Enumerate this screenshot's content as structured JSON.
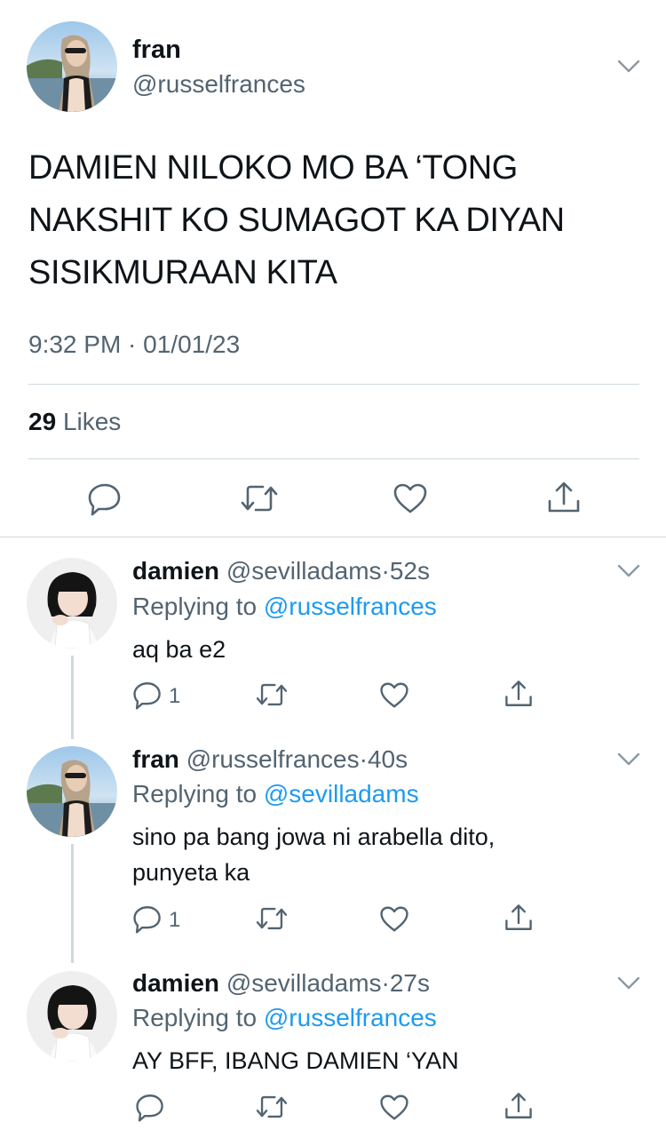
{
  "main_tweet": {
    "name": "fran",
    "handle": "@russelfrances",
    "text": "DAMIEN NILOKO MO BA ‘TONG NAKSHIT KO SUMAGOT KA DIYAN SISIKMURAAN KITA",
    "timestamp": "9:32 PM · 01/01/23",
    "likes_count": "29",
    "likes_label": "Likes",
    "actions": [
      "reply-icon",
      "retweet-icon",
      "like-icon",
      "share-icon"
    ]
  },
  "replies": [
    {
      "name": "damien",
      "handle": "@sevilladams",
      "time": "52s",
      "replying_prefix": "Replying to",
      "replying_to": "@russelfrances",
      "text": "aq ba e2",
      "reply_count": "1"
    },
    {
      "name": "fran",
      "handle": "@russelfrances",
      "time": "40s",
      "replying_prefix": "Replying to",
      "replying_to": "@sevilladams",
      "text": "sino pa bang jowa ni arabella dito, punyeta ka",
      "reply_count": "1"
    },
    {
      "name": "damien",
      "handle": "@sevilladams",
      "time": "27s",
      "replying_prefix": "Replying to",
      "replying_to": "@russelfrances",
      "text": "AY BFF, IBANG DAMIEN ‘YAN",
      "reply_count": ""
    }
  ],
  "colors": {
    "text": "#0f1419",
    "secondary": "#536471",
    "link": "#1d9bf0",
    "divider": "#cfd9de"
  }
}
